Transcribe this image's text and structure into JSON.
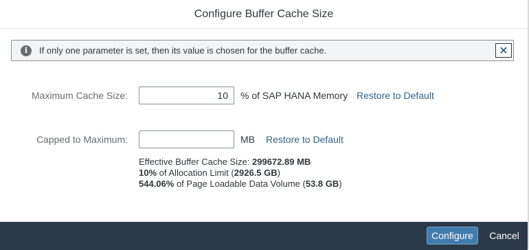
{
  "dialog": {
    "title": "Configure Buffer Cache Size"
  },
  "info_strip": {
    "icon": "info-icon",
    "message": "If only one parameter is set, then its value is chosen for the buffer cache.",
    "close_icon": "close-icon"
  },
  "max_cache": {
    "label": "Maximum Cache Size:",
    "value": "10",
    "unit": "% of SAP HANA Memory",
    "restore_label": "Restore to Default"
  },
  "capped": {
    "label": "Capped to Maximum:",
    "value": "",
    "unit": "MB",
    "restore_label": "Restore to Default"
  },
  "summary": {
    "line1_prefix": "Effective Buffer Cache Size: ",
    "line1_value": "299672.89 MB",
    "line2_value": "10%",
    "line2_text": " of Allocation Limit (",
    "line2_limit": "2926.5 GB",
    "line2_suffix": ")",
    "line3_value": "544.06%",
    "line3_text": " of Page Loadable Data Volume (",
    "line3_volume": "53.8 GB",
    "line3_suffix": ")"
  },
  "footer": {
    "configure_label": "Configure",
    "cancel_label": "Cancel"
  },
  "colors": {
    "accent": "#427cac",
    "footer_bg": "#2b3a4a",
    "link": "#346187"
  }
}
